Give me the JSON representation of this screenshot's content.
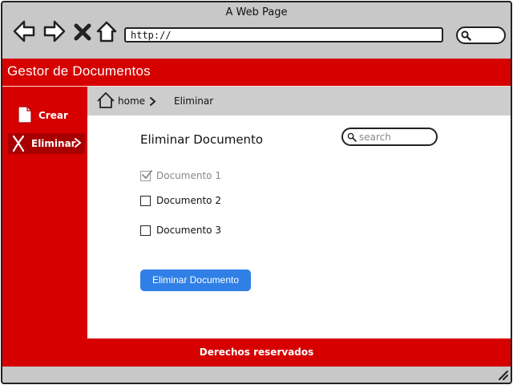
{
  "window": {
    "title": "A Web Page"
  },
  "browser": {
    "url": "http://",
    "icons": [
      "back-arrow-icon",
      "forward-arrow-icon",
      "close-icon",
      "home-icon",
      "search-icon"
    ]
  },
  "app": {
    "title": "Gestor de Documentos"
  },
  "sidebar": {
    "items": [
      {
        "label": "Crear",
        "icon": "document-icon"
      },
      {
        "label": "Eliminar",
        "icon": "x-icon",
        "active": true
      }
    ]
  },
  "breadcrumb": {
    "home": "home",
    "current": "Eliminar"
  },
  "main": {
    "title": "Eliminar Documento",
    "search_placeholder": "search",
    "documents": [
      {
        "label": "Documento 1",
        "checked": true,
        "disabled": true
      },
      {
        "label": "Documento 2",
        "checked": false
      },
      {
        "label": "Documento 3",
        "checked": false
      }
    ],
    "button_label": "Eliminar Documento"
  },
  "footer": {
    "text": "Derechos reservados"
  },
  "colors": {
    "brand": "#d60000",
    "sidebar_active": "#a80000",
    "button": "#2f7fe6",
    "breadcrumb_bg": "#cdcdcd"
  }
}
